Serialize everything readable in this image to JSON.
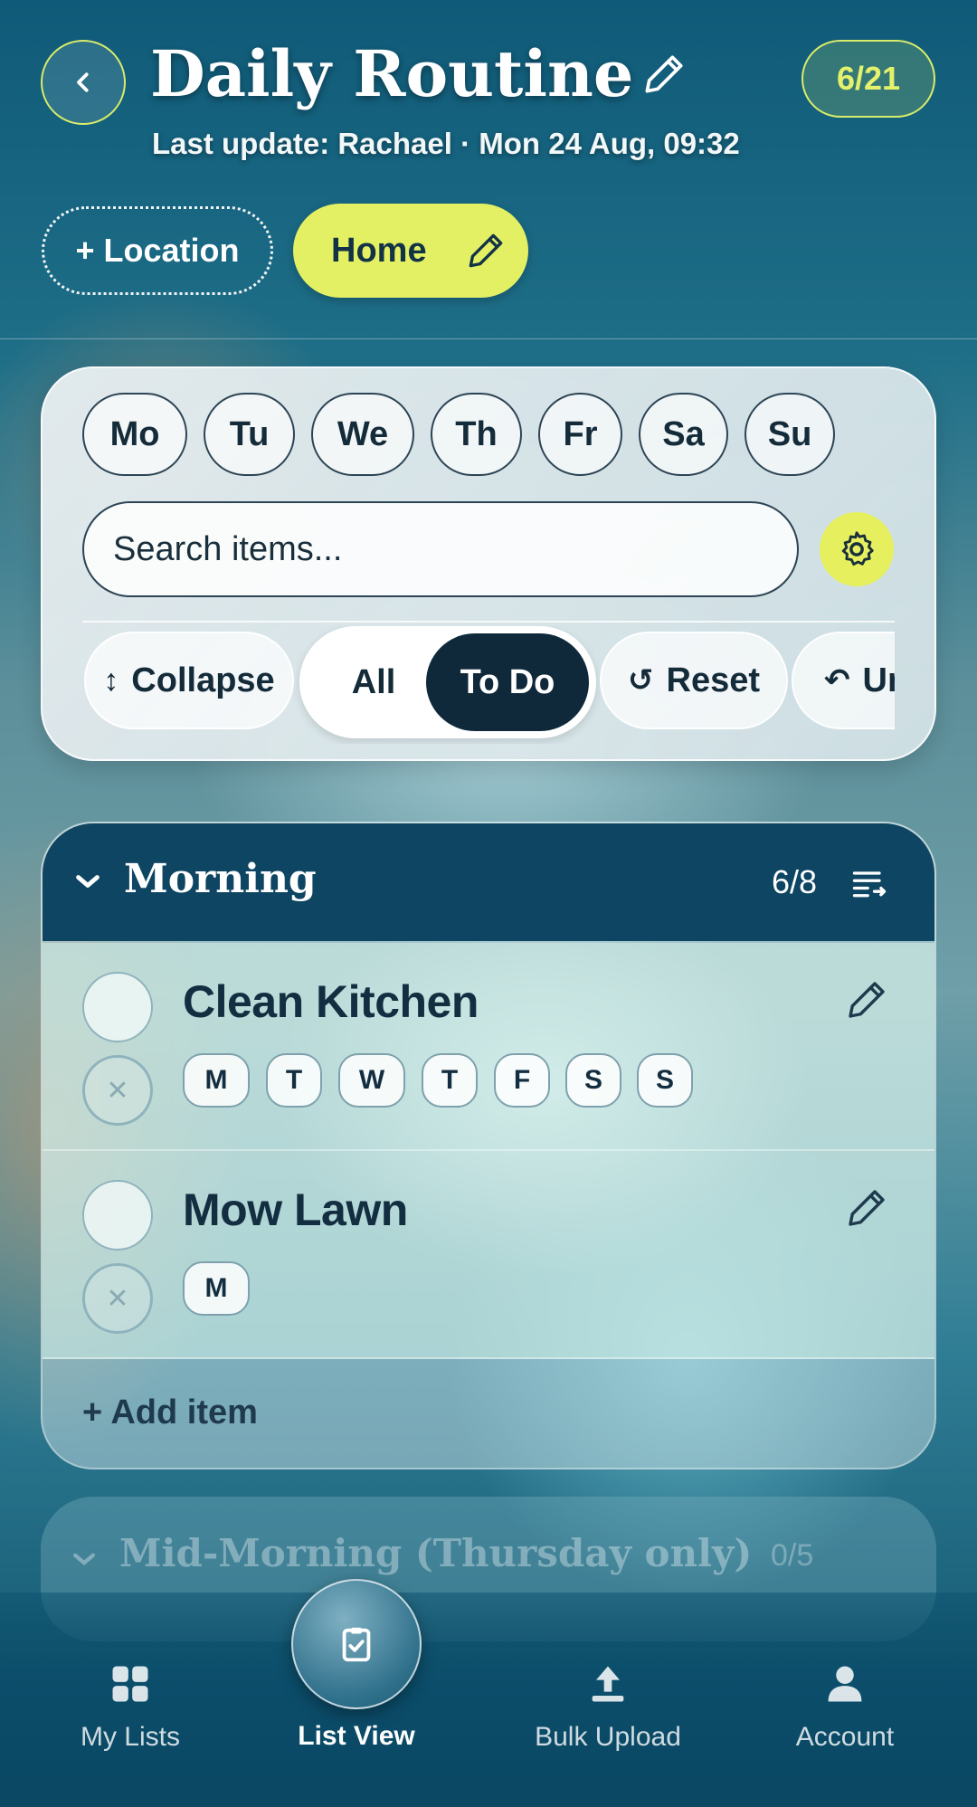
{
  "header": {
    "title": "Daily Routine",
    "subtitle": "Last update: Rachael · Mon 24 Aug, 09:32",
    "counter": "6/21"
  },
  "locations": {
    "add_label": "+ Location",
    "active_label": "Home"
  },
  "filters": {
    "days": [
      "Mo",
      "Tu",
      "We",
      "Th",
      "Fr",
      "Sa",
      "Su"
    ],
    "search_placeholder": "Search items...",
    "collapse_label": "Collapse",
    "seg_all": "All",
    "seg_todo": "To Do",
    "reset_label": "Reset",
    "undo_label": "Undo"
  },
  "sections": [
    {
      "title": "Morning",
      "count": "6/8",
      "items": [
        {
          "name": "Clean Kitchen",
          "days": [
            "M",
            "T",
            "W",
            "T",
            "F",
            "S",
            "S"
          ]
        },
        {
          "name": "Mow Lawn",
          "days": [
            "M"
          ]
        }
      ],
      "add_label": "+ Add item"
    },
    {
      "title": "Mid-Morning (Thursday only)",
      "count": "0/5"
    }
  ],
  "nav": {
    "items": [
      {
        "label": "My Lists",
        "icon": "grid-icon"
      },
      {
        "label": "List View",
        "icon": "clipboard-check-icon",
        "active": true
      },
      {
        "label": "Bulk Upload",
        "icon": "upload-icon"
      },
      {
        "label": "Account",
        "icon": "person-icon"
      }
    ]
  },
  "colors": {
    "accent": "#e4f064",
    "dark": "#10293a",
    "section_header": "#0e4562"
  }
}
